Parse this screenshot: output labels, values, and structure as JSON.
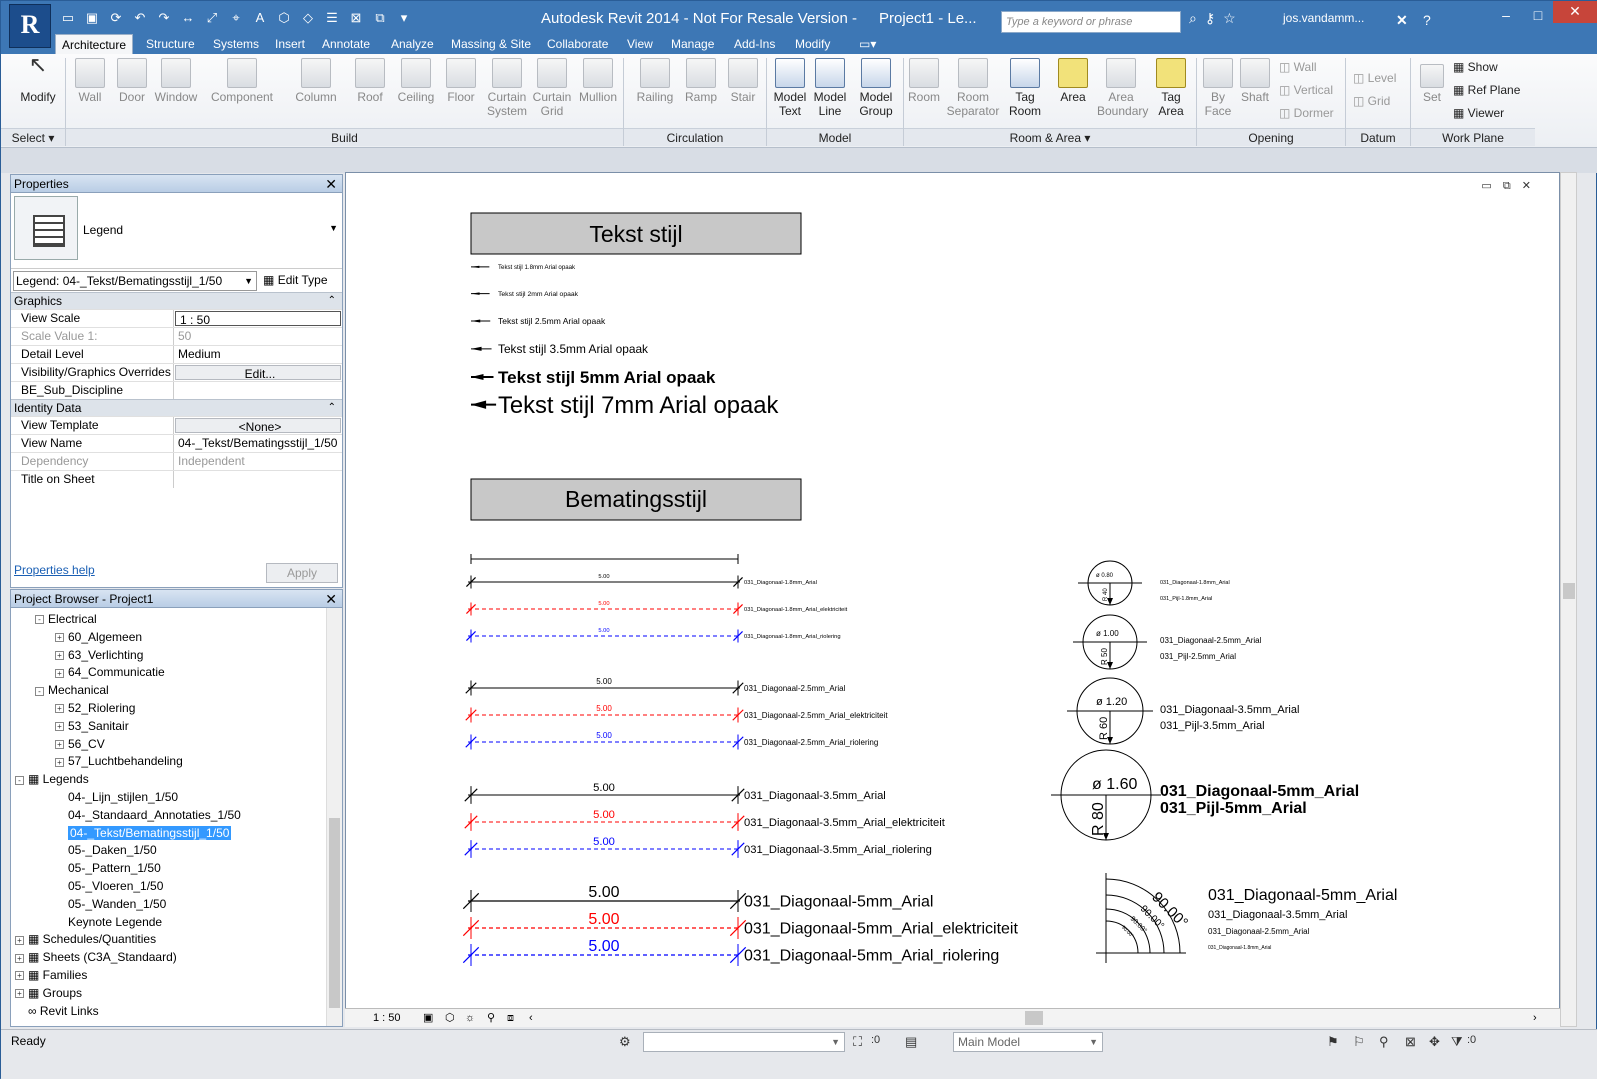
{
  "app": {
    "logo": "R",
    "title": "Autodesk Revit 2014 - Not For Resale Version -",
    "project_title": "Project1 - Le...",
    "search_placeholder": "Type a keyword or phrase",
    "user": "jos.vandamm..."
  },
  "tabs": [
    "Architecture",
    "Structure",
    "Systems",
    "Insert",
    "Annotate",
    "Analyze",
    "Massing & Site",
    "Collaborate",
    "View",
    "Manage",
    "Add-Ins",
    "Modify"
  ],
  "active_tab": "Architecture",
  "ribbon": {
    "modify": "Modify",
    "select": "Select",
    "build": [
      "Wall",
      "Door",
      "Window",
      "Component",
      "Column",
      "Roof",
      "Ceiling",
      "Floor",
      "Curtain System",
      "Curtain Grid",
      "Mullion"
    ],
    "build_label": "Build",
    "circulation": [
      "Railing",
      "Ramp",
      "Stair"
    ],
    "circulation_label": "Circulation",
    "model": [
      "Model Text",
      "Model Line",
      "Model Group"
    ],
    "model_label": "Model",
    "room_area": [
      "Room",
      "Room Separator",
      "Tag Room",
      "Area",
      "Area Boundary",
      "Tag Area"
    ],
    "room_area_label": "Room & Area",
    "opening": [
      "By Face",
      "Shaft"
    ],
    "opening_small": [
      "Wall",
      "Vertical",
      "Dormer"
    ],
    "opening_label": "Opening",
    "datum_small": [
      "Level",
      "Grid"
    ],
    "datum_label": "Datum",
    "workplane_set": "Set",
    "workplane_small": [
      "Show",
      "Ref Plane",
      "Viewer"
    ],
    "workplane_label": "Work Plane"
  },
  "properties": {
    "title": "Properties",
    "type_name": "Legend",
    "selector": "Legend: 04-_Tekst/Bematingsstijl_1/50",
    "edit_type": "Edit Type",
    "groups": [
      {
        "name": "Graphics",
        "rows": [
          {
            "k": "View Scale",
            "v": "1 : 50"
          },
          {
            "k": "Scale Value    1:",
            "v": "50"
          },
          {
            "k": "Detail Level",
            "v": "Medium"
          },
          {
            "k": "Visibility/Graphics Overrides",
            "v": "Edit..."
          },
          {
            "k": "BE_Sub_Discipline",
            "v": ""
          }
        ]
      },
      {
        "name": "Identity Data",
        "rows": [
          {
            "k": "View Template",
            "v": "<None>"
          },
          {
            "k": "View Name",
            "v": "04-_Tekst/Bematingsstijl_1/50"
          },
          {
            "k": "Dependency",
            "v": "Independent"
          },
          {
            "k": "Title on Sheet",
            "v": ""
          }
        ]
      }
    ],
    "help": "Properties help",
    "apply": "Apply"
  },
  "browser": {
    "title": "Project Browser - Project1",
    "items": [
      {
        "label": "Electrical",
        "level": 1,
        "pm": "-"
      },
      {
        "label": "60_Algemeen",
        "level": 2,
        "pm": "+"
      },
      {
        "label": "63_Verlichting",
        "level": 2,
        "pm": "+"
      },
      {
        "label": "64_Communicatie",
        "level": 2,
        "pm": "+"
      },
      {
        "label": "Mechanical",
        "level": 1,
        "pm": "-"
      },
      {
        "label": "52_Riolering",
        "level": 2,
        "pm": "+"
      },
      {
        "label": "53_Sanitair",
        "level": 2,
        "pm": "+"
      },
      {
        "label": "56_CV",
        "level": 2,
        "pm": "+"
      },
      {
        "label": "57_Luchtbehandeling",
        "level": 2,
        "pm": "+"
      },
      {
        "label": "Legends",
        "level": 0,
        "pm": "-"
      },
      {
        "label": "04-_Lijn_stijlen_1/50",
        "level": 2,
        "pm": ""
      },
      {
        "label": "04-_Standaard_Annotaties_1/50",
        "level": 2,
        "pm": ""
      },
      {
        "label": "04-_Tekst/Bematingsstijl_1/50",
        "level": 2,
        "pm": "",
        "selected": true
      },
      {
        "label": "05-_Daken_1/50",
        "level": 2,
        "pm": ""
      },
      {
        "label": "05-_Pattern_1/50",
        "level": 2,
        "pm": ""
      },
      {
        "label": "05-_Vloeren_1/50",
        "level": 2,
        "pm": ""
      },
      {
        "label": "05-_Wanden_1/50",
        "level": 2,
        "pm": ""
      },
      {
        "label": "Keynote Legende",
        "level": 2,
        "pm": ""
      },
      {
        "label": "Schedules/Quantities",
        "level": 0,
        "pm": "+"
      },
      {
        "label": "Sheets (C3A_Standaard)",
        "level": 0,
        "pm": "+"
      },
      {
        "label": "Families",
        "level": 0,
        "pm": "+"
      },
      {
        "label": "Groups",
        "level": 0,
        "pm": "+"
      },
      {
        "label": "Revit Links",
        "level": 0,
        "pm": ""
      }
    ]
  },
  "legend": {
    "text_header": "Tekst stijl",
    "text_styles": [
      {
        "label": "Tekst stijl 1.8mm Arial opaak",
        "size": 1.8
      },
      {
        "label": "Tekst stijl 2mm Arial opaak",
        "size": 2
      },
      {
        "label": "Tekst stijl 2.5mm Arial opaak",
        "size": 2.5
      },
      {
        "label": "Tekst stijl 3.5mm Arial opaak",
        "size": 3.5
      },
      {
        "label": "Tekst stijl 5mm Arial opaak",
        "size": 5
      },
      {
        "label": "Tekst stijl 7mm Arial opaak",
        "size": 7
      }
    ],
    "dim_header": "Bematingsstijl",
    "dim_value": "5.00",
    "dim_groups": [
      {
        "size": 1.8,
        "labels": [
          "031_Diagonaal-1.8mm_Arial",
          "031_Diagonaal-1.8mm_Arial_elektriciteit",
          "031_Diagonaal-1.8mm_Arial_riolering"
        ]
      },
      {
        "size": 2.5,
        "labels": [
          "031_Diagonaal-2.5mm_Arial",
          "031_Diagonaal-2.5mm_Arial_elektriciteit",
          "031_Diagonaal-2.5mm_Arial_riolering"
        ]
      },
      {
        "size": 3.5,
        "labels": [
          "031_Diagonaal-3.5mm_Arial",
          "031_Diagonaal-3.5mm_Arial_elektriciteit",
          "031_Diagonaal-3.5mm_Arial_riolering"
        ]
      },
      {
        "size": 5,
        "labels": [
          "031_Diagonaal-5mm_Arial",
          "031_Diagonaal-5mm_Arial_elektriciteit",
          "031_Diagonaal-5mm_Arial_riolering"
        ]
      }
    ],
    "colors": {
      "black": "#000000",
      "red": "#ff0000",
      "blue": "#0000ff"
    },
    "radial": [
      {
        "dia": "ø 0.80",
        "rad": "R 40",
        "labels": [
          "031_Diagonaal-1.8mm_Arial",
          "031_Pijl-1.8mm_Arial"
        ]
      },
      {
        "dia": "ø 1.00",
        "rad": "R 50",
        "labels": [
          "031_Diagonaal-2.5mm_Arial",
          "031_Pijl-2.5mm_Arial"
        ]
      },
      {
        "dia": "ø 1.20",
        "rad": "R 60",
        "labels": [
          "031_Diagonaal-3.5mm_Arial",
          "031_Pijl-3.5mm_Arial"
        ]
      },
      {
        "dia": "ø 1.60",
        "rad": "R 80",
        "labels": [
          "031_Diagonaal-5mm_Arial",
          "031_Pijl-5mm_Arial"
        ]
      }
    ],
    "angular": {
      "values": [
        "90.00°",
        "90.00°",
        "90.00°",
        "90.00°"
      ],
      "labels": [
        "031_Diagonaal-5mm_Arial",
        "031_Diagonaal-3.5mm_Arial",
        "031_Diagonaal-2.5mm_Arial",
        "031_Diagonaal-1.8mm_Arial"
      ]
    }
  },
  "viewbar": {
    "scale": "1 : 50"
  },
  "status": {
    "ready": "Ready",
    "count": ":0",
    "model": "Main Model",
    "filter": ":0"
  }
}
